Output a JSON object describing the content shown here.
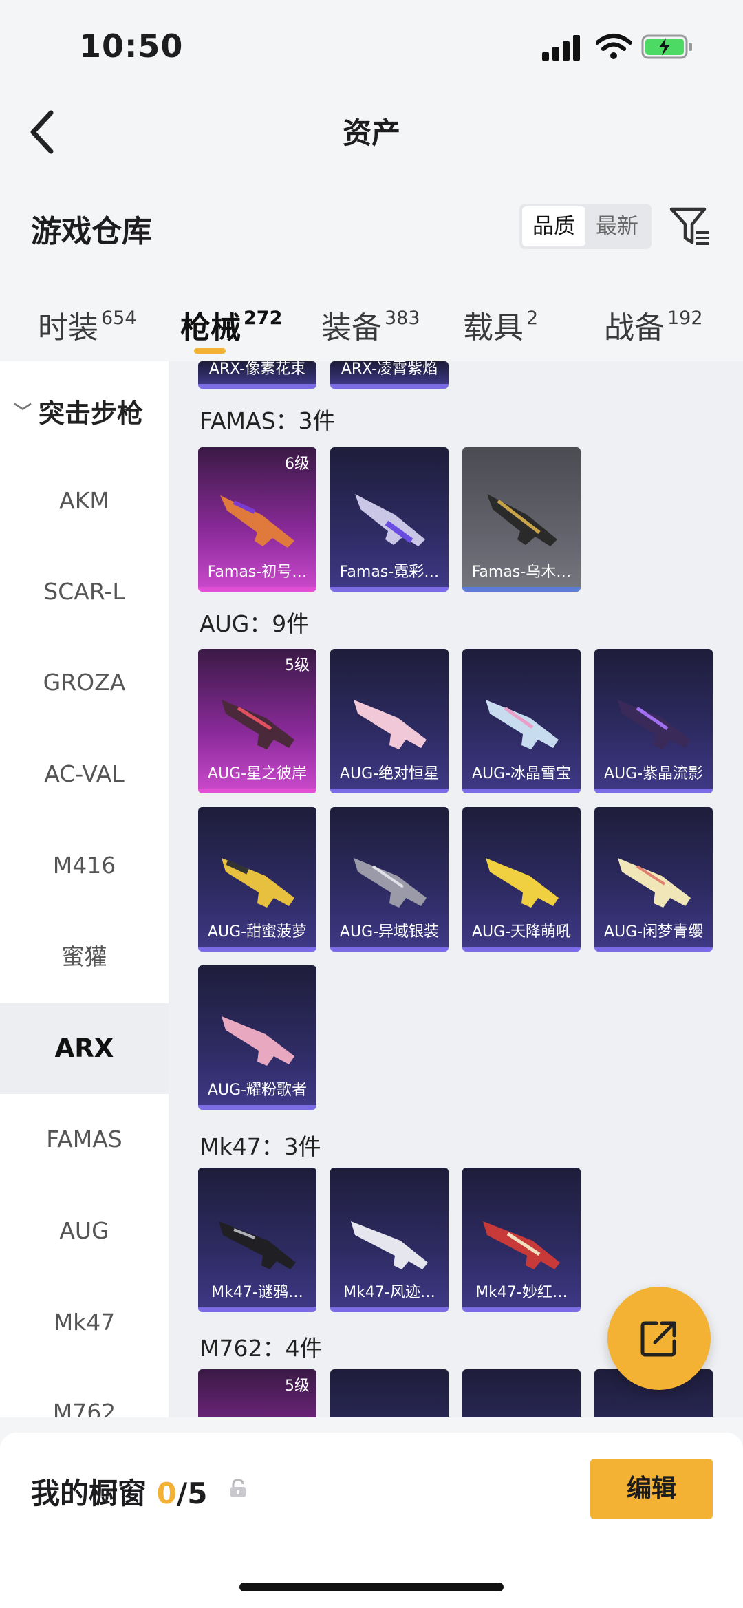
{
  "status": {
    "time": "10:50"
  },
  "nav": {
    "title": "资产"
  },
  "header": {
    "title": "游戏仓库",
    "sort_quality": "品质",
    "sort_latest": "最新"
  },
  "tabs": [
    {
      "label": "时装",
      "count": "654"
    },
    {
      "label": "枪械",
      "count": "272"
    },
    {
      "label": "装备",
      "count": "383"
    },
    {
      "label": "载具",
      "count": "2"
    },
    {
      "label": "战备",
      "count": "192"
    }
  ],
  "sidebar": {
    "group": "突击步枪",
    "items": [
      "AKM",
      "SCAR-L",
      "GROZA",
      "AC-VAL",
      "M416",
      "蜜獾",
      "ARX",
      "FAMAS",
      "AUG",
      "Mk47",
      "M762"
    ],
    "active": "ARX"
  },
  "sections": {
    "arx_partial": [
      "ARX-像素花束",
      "ARX-凌霄紫焰"
    ],
    "famas": {
      "title": "FAMAS：3件",
      "items": [
        {
          "name": "Famas-初号…",
          "level": "6级"
        },
        {
          "name": "Famas-霓彩…"
        },
        {
          "name": "Famas-乌木…"
        }
      ]
    },
    "aug": {
      "title": "AUG：9件",
      "items": [
        {
          "name": "AUG-星之彼岸",
          "level": "5级"
        },
        {
          "name": "AUG-绝对恒星"
        },
        {
          "name": "AUG-冰晶雪宝"
        },
        {
          "name": "AUG-紫晶流影"
        },
        {
          "name": "AUG-甜蜜菠萝"
        },
        {
          "name": "AUG-异域银装"
        },
        {
          "name": "AUG-天降萌吼"
        },
        {
          "name": "AUG-闲梦青缨"
        },
        {
          "name": "AUG-耀粉歌者"
        }
      ]
    },
    "mk47": {
      "title": "Mk47：3件",
      "items": [
        {
          "name": "Mk47-谜鸦…"
        },
        {
          "name": "Mk47-风迹…"
        },
        {
          "name": "Mk47-妙红…"
        }
      ]
    },
    "m762": {
      "title": "M762：4件",
      "first_level": "5级"
    }
  },
  "bottom": {
    "showcase_label": "我的橱窗",
    "showcase_count": "0",
    "showcase_total": "/5",
    "edit": "编辑"
  }
}
